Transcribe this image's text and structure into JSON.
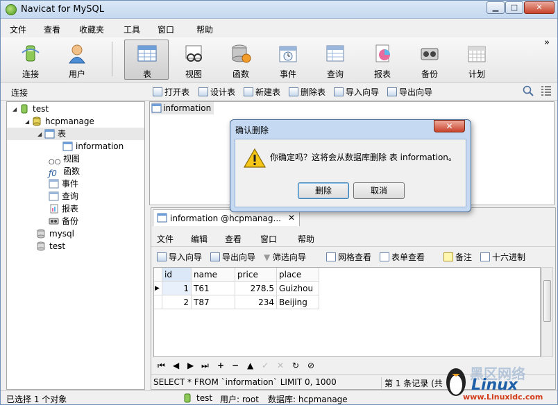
{
  "window": {
    "title": "Navicat for MySQL",
    "min": "▁",
    "max": "□",
    "close": "✕"
  },
  "menu": [
    "文件",
    "查看",
    "收藏夹",
    "工具",
    "窗口",
    "帮助"
  ],
  "toolbar": {
    "items": [
      {
        "label": "连接",
        "icon": "connection-icon"
      },
      {
        "label": "用户",
        "icon": "user-icon"
      },
      {
        "label": "表",
        "icon": "table-icon"
      },
      {
        "label": "视图",
        "icon": "view-icon"
      },
      {
        "label": "函数",
        "icon": "function-icon"
      },
      {
        "label": "事件",
        "icon": "event-icon"
      },
      {
        "label": "查询",
        "icon": "query-icon"
      },
      {
        "label": "报表",
        "icon": "report-icon"
      },
      {
        "label": "备份",
        "icon": "backup-icon"
      },
      {
        "label": "计划",
        "icon": "schedule-icon"
      }
    ],
    "overflow": "»"
  },
  "objectbar": {
    "title": "连接",
    "actions": [
      "打开表",
      "设计表",
      "新建表",
      "删除表",
      "导入向导",
      "导出向导"
    ]
  },
  "tree": {
    "connection": "test",
    "database": "hcpmanage",
    "tables_node": "表",
    "table": "information",
    "children": [
      "视图",
      "函数",
      "事件",
      "查询",
      "报表",
      "备份"
    ],
    "other_dbs": [
      "mysql",
      "test"
    ]
  },
  "objects": {
    "selected": "information"
  },
  "child": {
    "tab_title": "information @hcpmanag...",
    "tab_close": "✕",
    "menu": [
      "文件",
      "编辑",
      "查看",
      "窗口",
      "帮助"
    ],
    "tools": [
      "导入向导",
      "导出向导",
      "筛选向导",
      "网格查看",
      "表单查看",
      "备注",
      "十六进制"
    ],
    "columns": [
      "id",
      "name",
      "price",
      "place"
    ],
    "rows": [
      [
        "1",
        "T61",
        "278.5",
        "Guizhou"
      ],
      [
        "2",
        "T87",
        "234",
        "Beijing"
      ]
    ],
    "row_pointer": "▶",
    "nav": [
      "⏮",
      "◀",
      "▶",
      "⏭",
      "+",
      "−",
      "▲",
      "✓",
      "✕",
      "↻",
      "⊘"
    ],
    "sql": "SELECT * FROM `information` LIMIT 0, 1000",
    "record": "第 1 条记录 (共"
  },
  "dialog": {
    "title": "确认删除",
    "close": "✕",
    "message": "你确定吗？这将会从数据库删除 表 information。",
    "ok": "删除",
    "cancel": "取消"
  },
  "status": {
    "selection": "已选择 1 个对象",
    "connection": "test",
    "user": "用户: root",
    "database": "数据库: hcpmanage"
  },
  "watermark": {
    "brand": "Linux",
    "site": "www.Linuxidc.com",
    "tag": "黑区网络"
  }
}
